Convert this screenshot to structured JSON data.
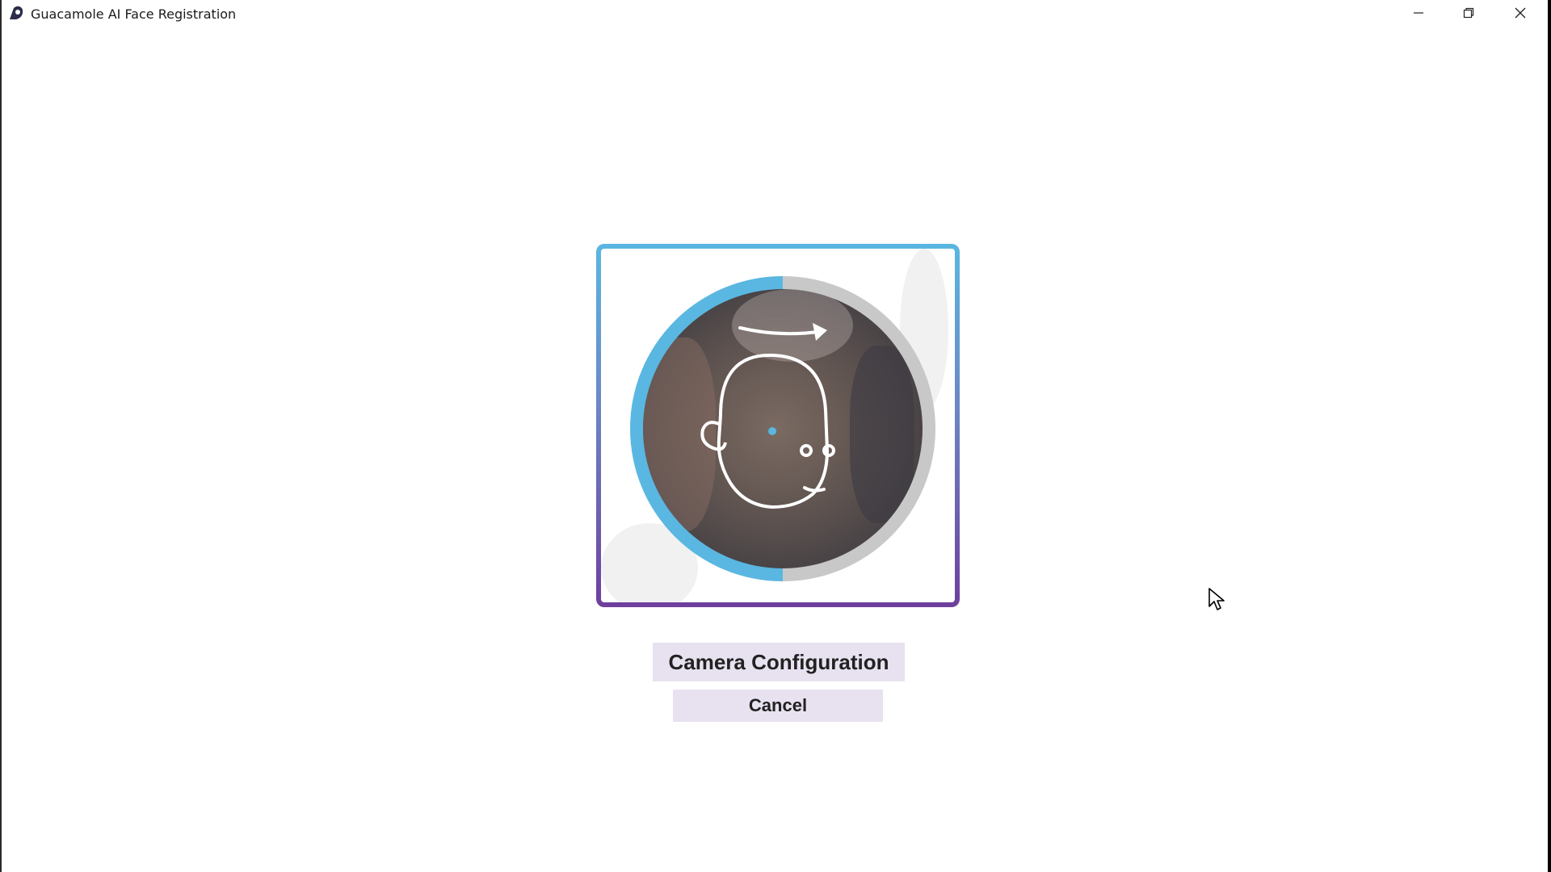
{
  "window": {
    "title": "Guacamole AI Face Registration",
    "app_icon": "guacamole-logo-icon",
    "controls": {
      "minimize_icon": "minimize-icon",
      "restore_icon": "restore-icon",
      "close_icon": "close-icon"
    }
  },
  "registration": {
    "scan_progress": 0.5,
    "guide_icon": "face-turn-right-guide-icon",
    "colors": {
      "ring_progress": "#5ab7e1",
      "ring_remaining": "#c8c8c8",
      "frame_top": "#5ab7e1",
      "frame_bottom": "#6e3f9c",
      "focus_dot": "#5ab7e1"
    }
  },
  "actions": {
    "camera_configuration_label": "Camera Configuration",
    "cancel_label": "Cancel",
    "button_bg": "#e8e2f0"
  }
}
